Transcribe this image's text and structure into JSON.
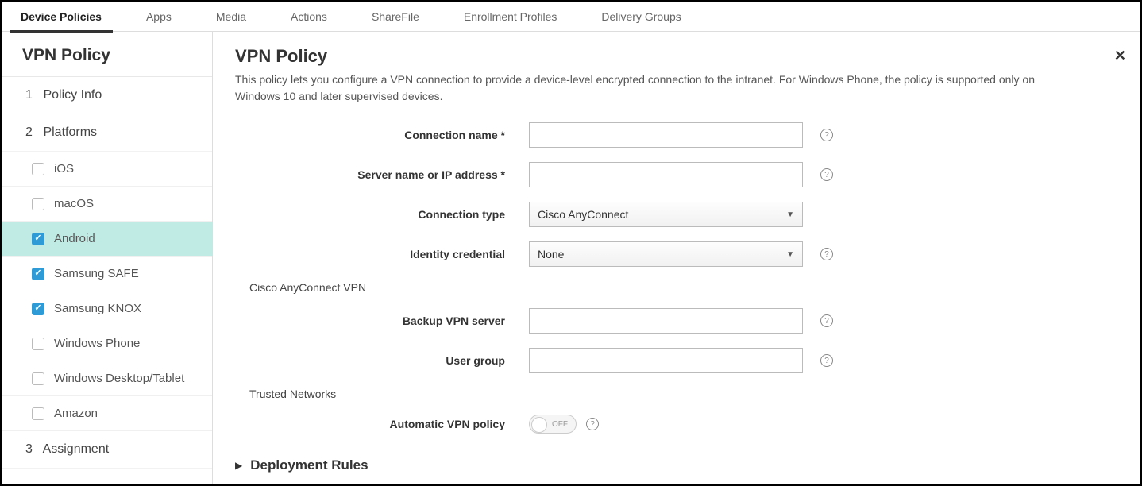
{
  "topTabs": [
    {
      "label": "Device Policies",
      "active": true
    },
    {
      "label": "Apps",
      "active": false
    },
    {
      "label": "Media",
      "active": false
    },
    {
      "label": "Actions",
      "active": false
    },
    {
      "label": "ShareFile",
      "active": false
    },
    {
      "label": "Enrollment Profiles",
      "active": false
    },
    {
      "label": "Delivery Groups",
      "active": false
    }
  ],
  "sidebar": {
    "title": "VPN Policy",
    "steps": {
      "policyInfo": {
        "num": "1",
        "label": "Policy Info"
      },
      "platforms": {
        "num": "2",
        "label": "Platforms"
      },
      "assignment": {
        "num": "3",
        "label": "Assignment"
      }
    },
    "platforms": [
      {
        "label": "iOS",
        "checked": false,
        "selected": false
      },
      {
        "label": "macOS",
        "checked": false,
        "selected": false
      },
      {
        "label": "Android",
        "checked": true,
        "selected": true
      },
      {
        "label": "Samsung SAFE",
        "checked": true,
        "selected": false
      },
      {
        "label": "Samsung KNOX",
        "checked": true,
        "selected": false
      },
      {
        "label": "Windows Phone",
        "checked": false,
        "selected": false
      },
      {
        "label": "Windows Desktop/Tablet",
        "checked": false,
        "selected": false
      },
      {
        "label": "Amazon",
        "checked": false,
        "selected": false
      }
    ]
  },
  "content": {
    "title": "VPN Policy",
    "description": "This policy lets you configure a VPN connection to provide a device-level encrypted connection to the intranet. For Windows Phone, the policy is supported only on Windows 10 and later supervised devices.",
    "fields": {
      "connectionName": {
        "label": "Connection name *",
        "value": ""
      },
      "serverName": {
        "label": "Server name or IP address *",
        "value": ""
      },
      "connectionType": {
        "label": "Connection type",
        "value": "Cisco AnyConnect"
      },
      "identityCredential": {
        "label": "Identity credential",
        "value": "None"
      },
      "backupVpn": {
        "label": "Backup VPN server",
        "value": ""
      },
      "userGroup": {
        "label": "User group",
        "value": ""
      },
      "autoVpnPolicy": {
        "label": "Automatic VPN policy",
        "value": "OFF"
      }
    },
    "sections": {
      "ciscoVpn": "Cisco AnyConnect VPN",
      "trustedNetworks": "Trusted Networks",
      "deploymentRules": "Deployment Rules"
    }
  }
}
